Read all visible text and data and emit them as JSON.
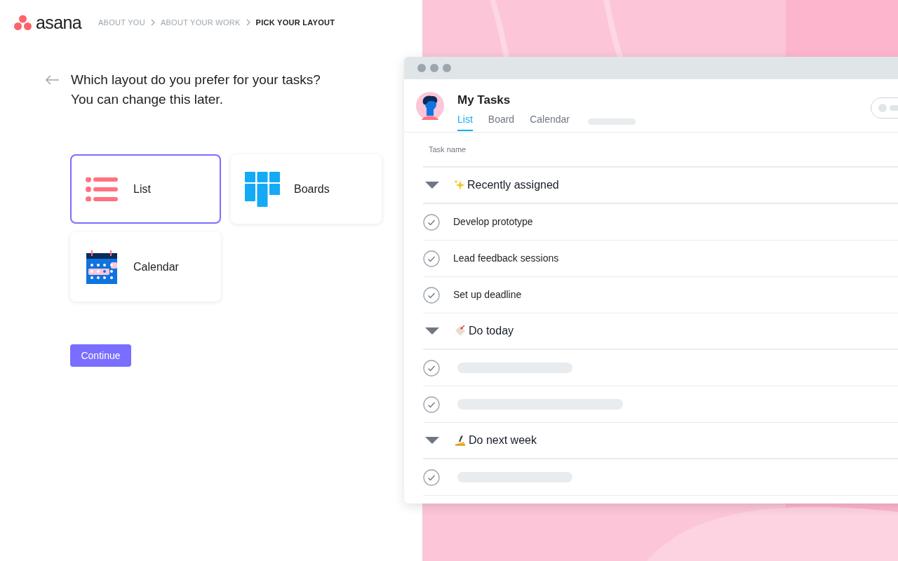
{
  "logo": {
    "name": "asana"
  },
  "breadcrumbs": [
    {
      "label": "ABOUT YOU",
      "selected": false
    },
    {
      "label": "ABOUT YOUR WORK",
      "selected": false
    },
    {
      "label": "PICK YOUR LAYOUT",
      "selected": true
    }
  ],
  "question": {
    "lines": [
      "Which layout do you prefer for your tasks?",
      "You can change this later."
    ]
  },
  "options": [
    {
      "label": "List",
      "kind": "list",
      "selected": true
    },
    {
      "label": "Boards",
      "kind": "boards",
      "selected": false
    },
    {
      "label": "Calendar",
      "kind": "calendar",
      "selected": false
    }
  ],
  "continue_button": "Continue",
  "preview": {
    "title": "My Tasks",
    "tabs": [
      {
        "label": "List",
        "selected": true
      },
      {
        "label": "Board",
        "selected": false
      },
      {
        "label": "Calendar",
        "selected": false
      }
    ],
    "column": "Task name",
    "sections": [
      {
        "title": "Recently assigned",
        "kind": "sparkles",
        "expanded": true,
        "tasks": [
          {
            "kind": "task",
            "name": "Develop prototype"
          },
          {
            "kind": "task",
            "name": "Lead feedback sessions"
          },
          {
            "kind": "task",
            "name": "Set up deadline"
          }
        ]
      },
      {
        "title": "Do today",
        "kind": "tag",
        "expanded": true,
        "tasks": [
          {
            "kind": "placeholder"
          },
          {
            "kind": "placeholder"
          }
        ]
      },
      {
        "title": "Do next week",
        "kind": "writing",
        "expanded": true,
        "tasks": [
          {
            "kind": "placeholder"
          }
        ]
      }
    ]
  }
}
